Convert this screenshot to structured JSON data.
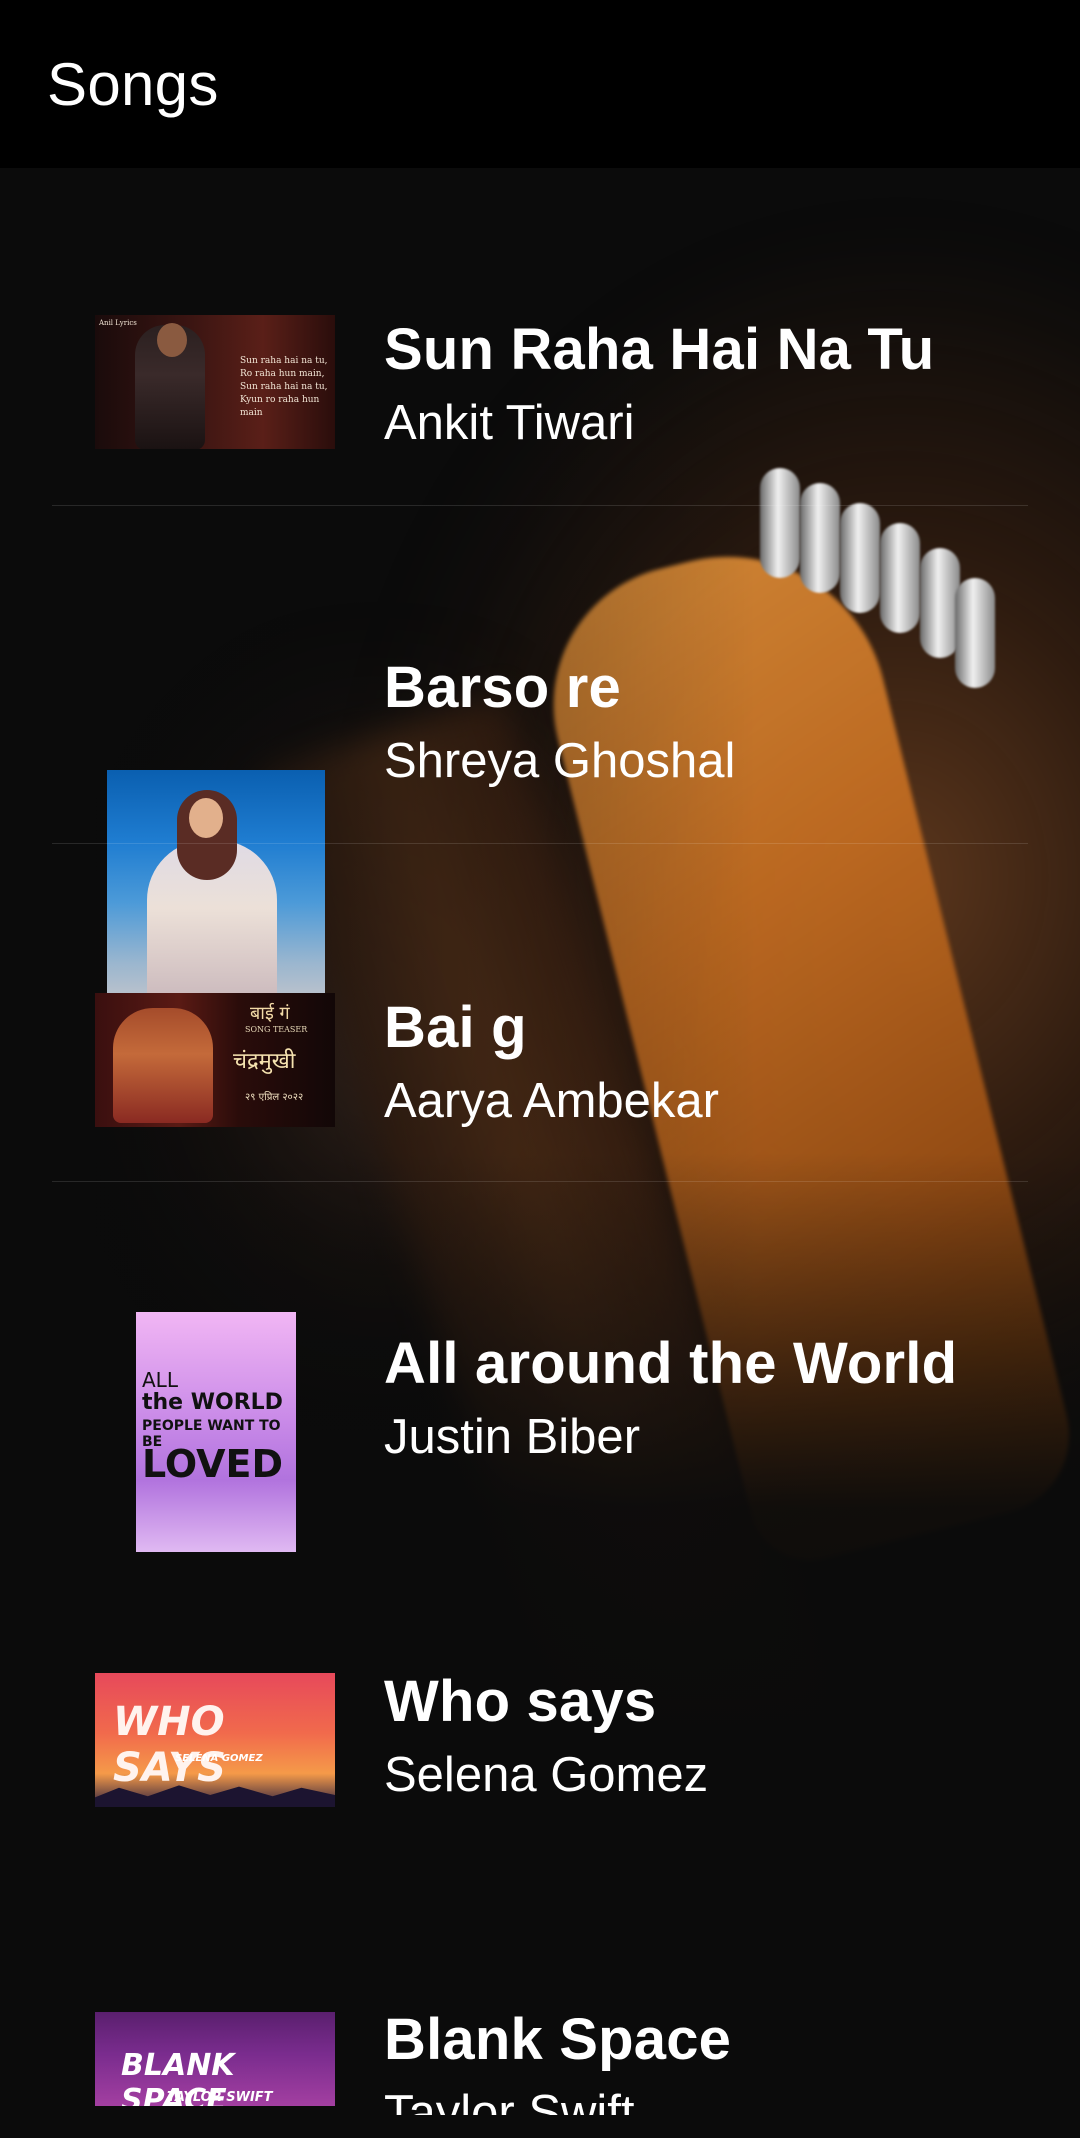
{
  "app_bar": {
    "title": "Songs"
  },
  "songs": [
    {
      "title": "Sun Raha Hai Na Tu",
      "artist": "Ankit Tiwari",
      "thumb_icon": "album-art-ankit-tiwari",
      "thumb_caption": [
        "Sun raha hai na tu,",
        "Ro raha hun main,",
        "Sun raha hai na tu,",
        "Kyun ro raha hun main"
      ],
      "thumb_tag": "Anil Lyrics"
    },
    {
      "title": "Barso re",
      "artist": "Shreya Ghoshal",
      "thumb_icon": "album-art-shreya-ghoshal"
    },
    {
      "title": "Bai g",
      "artist": "Aarya Ambekar",
      "thumb_icon": "album-art-chandramukhi",
      "thumb_caption": [
        "बाई गं",
        "SONG TEASER",
        "चंद्रमुखी",
        "२९ एप्रिल २०२२"
      ]
    },
    {
      "title": "All around the World",
      "artist": "Justin Biber",
      "thumb_icon": "album-art-all-around-the-world",
      "thumb_caption": [
        "ALL",
        "the WORLD",
        "PEOPLE WANT TO BE",
        "LOVED"
      ]
    },
    {
      "title": "Who says",
      "artist": "Selena Gomez",
      "thumb_icon": "album-art-who-says",
      "thumb_caption": [
        "WHO SAYS",
        "SELENA GOMEZ"
      ]
    },
    {
      "title": "Blank Space",
      "artist": "Taylor Swift",
      "thumb_icon": "album-art-blank-space",
      "thumb_caption": [
        "BLANK SPACE",
        "TAYLOR SWIFT"
      ]
    }
  ],
  "colors": {
    "app_bar_bg": "#000000",
    "list_bg": "#0b0b0b",
    "text": "#ffffff"
  }
}
